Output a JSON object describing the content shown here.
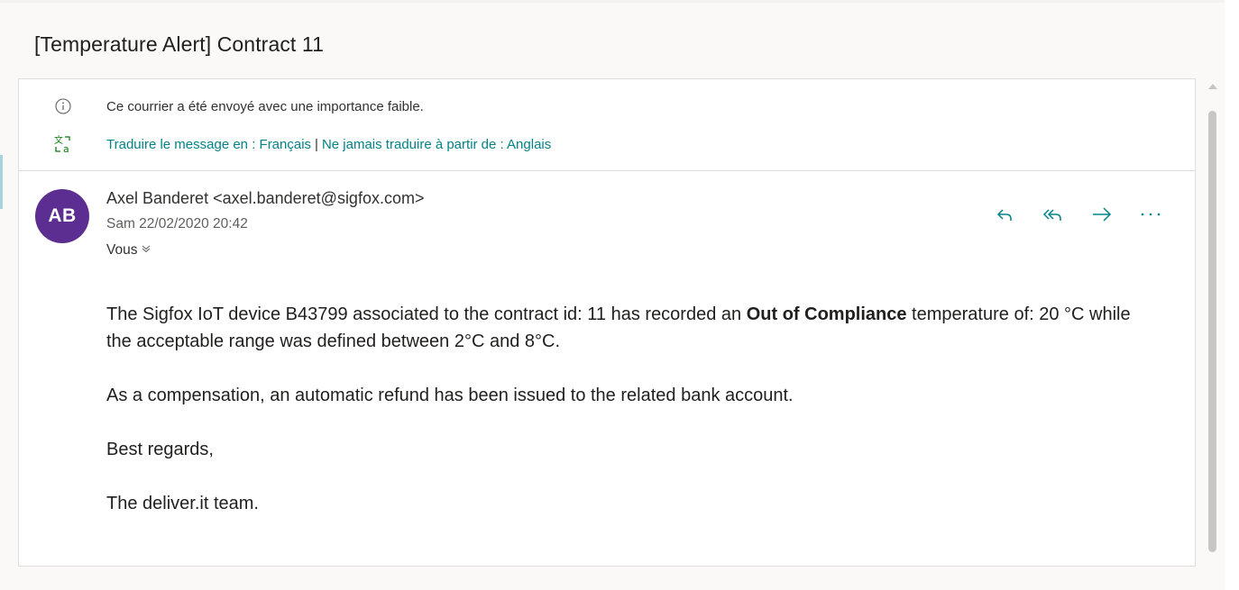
{
  "message": {
    "subject": "[Temperature Alert] Contract 11",
    "importance_notice": "Ce courrier a été envoyé avec une importance faible.",
    "translate": {
      "translate_link": "Traduire le message en : Français",
      "separator": "|",
      "never_translate_link": "Ne jamais traduire à partir de : Anglais"
    },
    "sender": {
      "initials": "AB",
      "display": "Axel Banderet <axel.banderet@sigfox.com>",
      "avatar_color": "#5c2e91"
    },
    "date": "Sam 22/02/2020 20:42",
    "to_label": "Vous",
    "actions": {
      "reply": "reply-icon",
      "reply_all": "reply-all-icon",
      "forward": "forward-icon",
      "more": "more-icon"
    },
    "body": {
      "p1_before": "The Sigfox IoT device B43799 associated to the contract id: 11 has recorded an ",
      "p1_bold": "Out of Compliance",
      "p1_after": " temperature of: 20 °C while the acceptable range was defined between 2°C and 8°C.",
      "p2": "As a compensation, an automatic refund has been issued to the related bank account.",
      "p3": "Best regards,",
      "p4": "The deliver.it team."
    }
  },
  "colors": {
    "accent_teal": "#038387",
    "text": "#323130"
  }
}
